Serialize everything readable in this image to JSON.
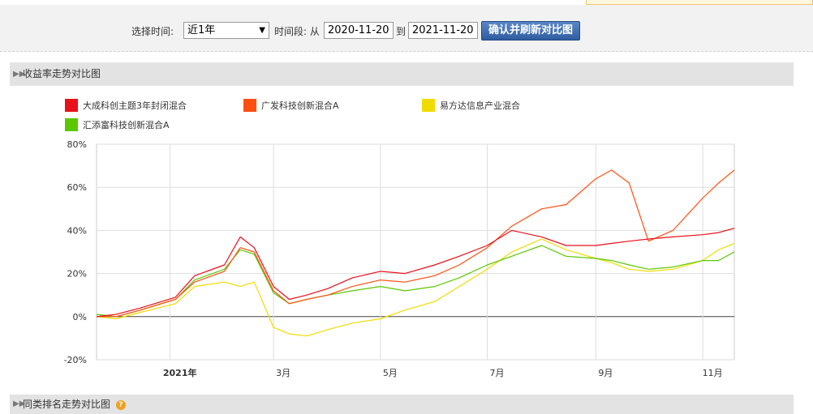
{
  "toolbar": {
    "select_time_label": "选择时间:",
    "period_value": "近1年",
    "time_range_label": "时间段: 从",
    "start_date": "2020-11-20",
    "to_label": "到",
    "end_date": "2021-11-20",
    "confirm_label": "确认并刷新对比图"
  },
  "sections": {
    "return_trend_title": "收益率走势对比图",
    "rank_trend_title": "同类排名走势对比图"
  },
  "colors": {
    "series1": "#e8101a",
    "series2": "#ff4f10",
    "series3": "#f0dc00",
    "series4": "#5ac800"
  },
  "chart_data": {
    "type": "line",
    "y_unit": "%",
    "ylim": [
      -20,
      80
    ],
    "yticks": [
      "80%",
      "60%",
      "40%",
      "20%",
      "0%",
      "-20%"
    ],
    "xticks": [
      "2021年",
      "3月",
      "5月",
      "7月",
      "9月",
      "11月"
    ],
    "grid": true,
    "legend_position": "top-left",
    "x_dates": [
      "2020-11-20",
      "2020-12-01",
      "2020-12-15",
      "2021-01-04",
      "2021-01-15",
      "2021-02-01",
      "2021-02-10",
      "2021-02-18",
      "2021-03-01",
      "2021-03-10",
      "2021-03-20",
      "2021-04-01",
      "2021-04-15",
      "2021-05-01",
      "2021-05-15",
      "2021-06-01",
      "2021-06-15",
      "2021-07-01",
      "2021-07-15",
      "2021-08-01",
      "2021-08-15",
      "2021-09-01",
      "2021-09-10",
      "2021-09-20",
      "2021-10-01",
      "2021-10-15",
      "2021-11-01",
      "2021-11-10",
      "2021-11-19"
    ],
    "series": [
      {
        "name": "大成科创主题3年封闭混合",
        "values": [
          0,
          1,
          4,
          9,
          19,
          24,
          37,
          32,
          14,
          8,
          10,
          13,
          18,
          21,
          20,
          24,
          28,
          33,
          40,
          37,
          33,
          33,
          34,
          35,
          36,
          37,
          38,
          39,
          41
        ]
      },
      {
        "name": "广发科技创新混合A",
        "values": [
          0,
          0,
          3,
          8,
          16,
          21,
          32,
          30,
          12,
          6,
          8,
          10,
          14,
          17,
          16,
          19,
          24,
          32,
          42,
          50,
          52,
          64,
          68,
          62,
          35,
          40,
          55,
          62,
          68
        ]
      },
      {
        "name": "易方达信息产业混合",
        "values": [
          0,
          -1,
          2,
          6,
          14,
          16,
          14,
          16,
          -5,
          -8,
          -9,
          -6,
          -3,
          -1,
          3,
          7,
          14,
          22,
          30,
          36,
          31,
          27,
          25,
          22,
          21,
          22,
          26,
          31,
          34
        ]
      },
      {
        "name": "汇添富科技创新混合A",
        "values": [
          1,
          0,
          3,
          8,
          17,
          22,
          31,
          29,
          11,
          6,
          8,
          10,
          12,
          14,
          12,
          14,
          18,
          24,
          28,
          33,
          28,
          27,
          26,
          24,
          22,
          23,
          26,
          26,
          30
        ]
      }
    ]
  }
}
